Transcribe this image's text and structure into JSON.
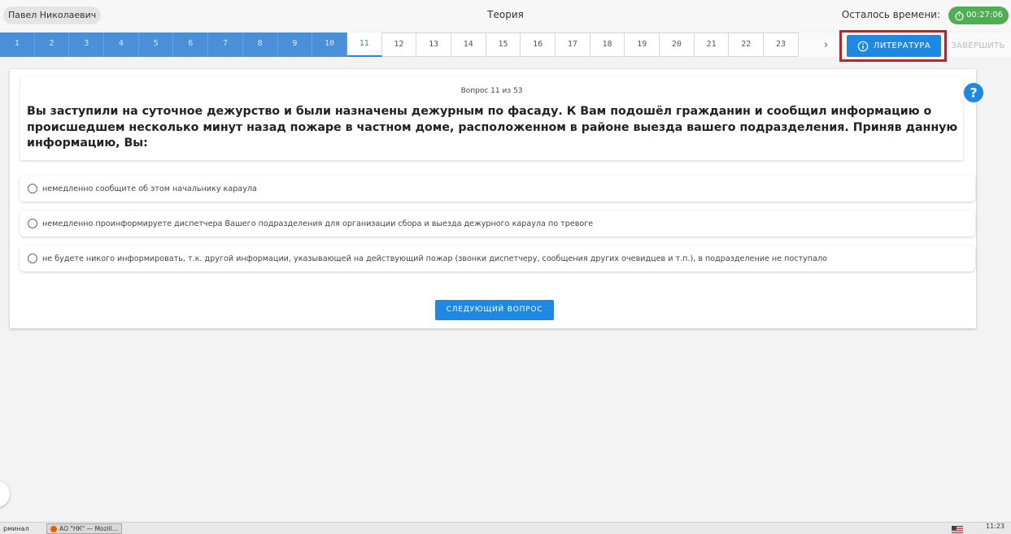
{
  "header": {
    "user_name": "Павел Николаевич",
    "title": "Теория",
    "time_left_label": "Осталось времени:",
    "timer": "00:27:06"
  },
  "nav": {
    "questions": [
      {
        "n": "1",
        "state": "done"
      },
      {
        "n": "2",
        "state": "done"
      },
      {
        "n": "3",
        "state": "done"
      },
      {
        "n": "4",
        "state": "done"
      },
      {
        "n": "5",
        "state": "done"
      },
      {
        "n": "6",
        "state": "done"
      },
      {
        "n": "7",
        "state": "done"
      },
      {
        "n": "8",
        "state": "done"
      },
      {
        "n": "9",
        "state": "done"
      },
      {
        "n": "10",
        "state": "done"
      },
      {
        "n": "11",
        "state": "current"
      },
      {
        "n": "12",
        "state": "todo"
      },
      {
        "n": "13",
        "state": "todo"
      },
      {
        "n": "14",
        "state": "todo"
      },
      {
        "n": "15",
        "state": "todo"
      },
      {
        "n": "16",
        "state": "todo"
      },
      {
        "n": "17",
        "state": "todo"
      },
      {
        "n": "18",
        "state": "todo"
      },
      {
        "n": "19",
        "state": "todo"
      },
      {
        "n": "20",
        "state": "todo"
      },
      {
        "n": "21",
        "state": "todo"
      },
      {
        "n": "22",
        "state": "todo"
      },
      {
        "n": "23",
        "state": "todo"
      }
    ],
    "next_arrow": "›",
    "literature_label": "ЛИТЕРАТУРА",
    "finish_label": "ЗАВЕРШИТЬ"
  },
  "question": {
    "counter": "Вопрос 11 из 53",
    "text": "Вы заступили на суточное дежурство и были назначены дежурным по фасаду. К Вам подошёл гражданин и сообщил информацию о происшедшем несколько минут назад пожаре в частном доме, расположенном в районе выезда вашего подразделения. Приняв данную информацию, Вы:",
    "answers": [
      "немедленно сообщите об этом начальнику караула",
      "немедленно проинформируете диспетчера Вашего подразделения для организации сбора и выезда дежурного караула по тревоге",
      "не будете никого информировать, т.к. другой информации, указывающей на действующий пожар (звонки диспетчеру, сообщения других очевидцев и т.п.), в подразделение не поступало"
    ],
    "next_button": "СЛЕДУЮЩИЙ ВОПРОС"
  },
  "taskbar": {
    "terminal": "рминал",
    "window": "АО \"НК\" — Mozill…",
    "clock": "11:23"
  },
  "colors": {
    "primary": "#1e88e5",
    "done": "#4a90d9",
    "timer": "#4caf50",
    "highlight": "#d9151d"
  }
}
